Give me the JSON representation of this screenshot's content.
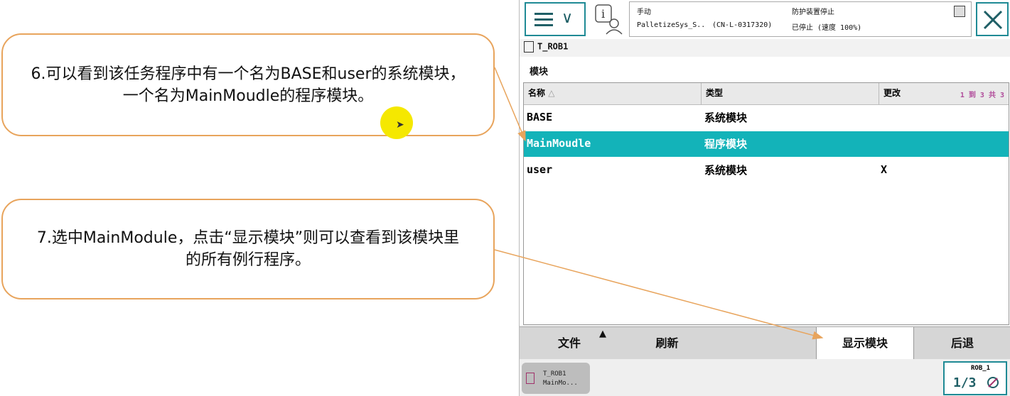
{
  "callouts": {
    "step6_line1": "6.可以看到该任务程序中有一个名为BASE和user的系统模块，",
    "step6_line2": "一个名为MainMoudle的程序模块。",
    "step7_line1": "7.选中MainModule，点击“显示模块”则可以查看到该模块里",
    "step7_line2": "的所有例行程序。"
  },
  "status": {
    "mode": "手动",
    "system": "PalletizeSys_S..",
    "controller": "(CN-L-0317320)",
    "guard": "防护装置停止",
    "state": "已停止 (速度 100%)"
  },
  "task_label": "T_ROB1",
  "section_title": "模块",
  "table": {
    "headers": {
      "name": "名称",
      "type": "类型",
      "changed": "更改"
    },
    "pager": "1 到 3 共 3",
    "rows": [
      {
        "name": "BASE",
        "type": "系统模块",
        "changed": ""
      },
      {
        "name": "MainMoudle",
        "type": "程序模块",
        "changed": ""
      },
      {
        "name": "user",
        "type": "系统模块",
        "changed": "X"
      }
    ],
    "selected_row": 1
  },
  "bottom_buttons": {
    "file": "文件",
    "refresh": "刷新",
    "show_module": "显示模块",
    "back": "后退"
  },
  "taskbar": {
    "tab_line1": "T_ROB1",
    "tab_line2": "MainMo...",
    "robot": "ROB_1",
    "fraction": "1/3"
  },
  "colors": {
    "accent": "#13b3b9",
    "callout_border": "#e8a45c",
    "arrow": "#e8a45c",
    "pointer": "#f5e800"
  },
  "icons": {
    "menu": "hamburger-menu-icon",
    "info": "operator-info-icon",
    "close": "close-icon",
    "task": "task-program-icon",
    "up": "caret-up-icon",
    "quickset": "quickset-gear-icon"
  }
}
